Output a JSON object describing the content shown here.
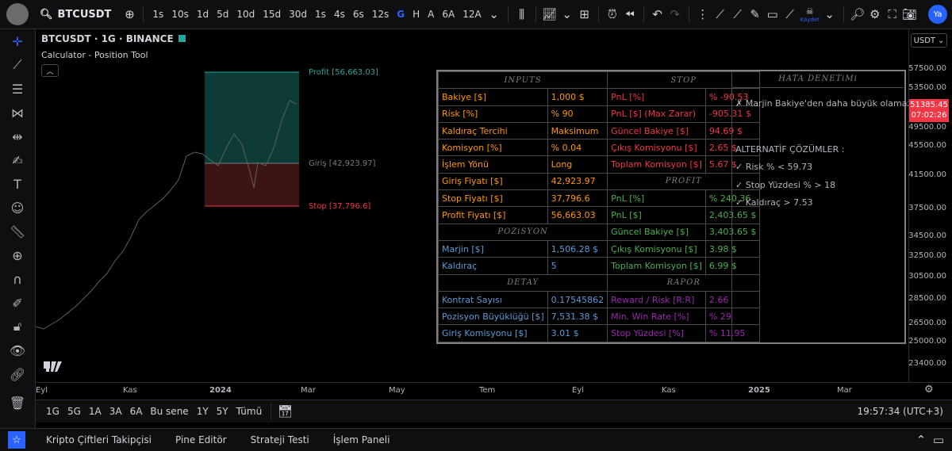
{
  "topbar": {
    "symbol": "BTCUSDT",
    "intervals": [
      "1s",
      "10s",
      "1d",
      "5d",
      "10d",
      "15d",
      "30d",
      "1s",
      "4s",
      "6s",
      "12s",
      "G",
      "H",
      "A",
      "6A",
      "12A"
    ],
    "active_interval": "G",
    "profile_label": "Ya",
    "save_label": "Kaydet"
  },
  "chart": {
    "title": "BTCUSDT · 1G · BINANCE",
    "indicator": "Calculator - Position Tool",
    "profit_label": "Profit [56,663.03]",
    "entry_label": "Giriş [42,923.97]",
    "stop_label": "Stop [37,796.6]",
    "currency": "USDT",
    "current_price": "51385.45",
    "countdown": "07:02:26",
    "price_ticks": [
      "57500.00",
      "53500.00",
      "49500.00",
      "45500.00",
      "41500.00",
      "37500.00",
      "34500.00",
      "32500.00",
      "30500.00",
      "28500.00",
      "26500.00",
      "25000.00",
      "23400.00"
    ],
    "time_ticks": [
      "Eyl",
      "Kas",
      "2024",
      "Mar",
      "May",
      "Tem",
      "Eyl",
      "Kas",
      "2025",
      "Mar"
    ]
  },
  "table": {
    "inputs_header": "INPUTS",
    "stop_header": "STOP",
    "profit_header": "PROFIT",
    "position_header": "POZiSYON",
    "detail_header": "DETAY",
    "report_header": "RAPOR",
    "check_header": "HATA DENETiMi",
    "inputs": [
      {
        "label": "Bakiye [$]",
        "value": "1,000 $"
      },
      {
        "label": "Risk [%]",
        "value": "% 90"
      },
      {
        "label": "Kaldıraç Tercihi",
        "value": "Maksimum"
      },
      {
        "label": "Komisyon [%]",
        "value": "% 0.04"
      },
      {
        "label": "İşlem Yönü",
        "value": "Long"
      },
      {
        "label": "Giriş Fiyatı [$]",
        "value": "42,923.97"
      },
      {
        "label": "Stop Fiyatı [$]",
        "value": "37,796.6"
      },
      {
        "label": "Profit Fiyatı [$]",
        "value": "56,663.03"
      }
    ],
    "stop": [
      {
        "label": "PnL [%]",
        "value": "% -90.53"
      },
      {
        "label": "PnL [$] (Max Zarar)",
        "value": "-905.31 $"
      },
      {
        "label": "Güncel Bakiye [$]",
        "value": "94.69 $"
      },
      {
        "label": "Çıkış Komisyonu [$]",
        "value": "2.65 $"
      },
      {
        "label": "Toplam Komisyon [$]",
        "value": "5.67 $"
      }
    ],
    "profit": [
      {
        "label": "PnL [%]",
        "value": "% 240.36"
      },
      {
        "label": "PnL [$]",
        "value": "2,403.65 $"
      },
      {
        "label": "Güncel Bakiye [$]",
        "value": "3,403.65 $"
      },
      {
        "label": "Çıkış Komisyonu [$]",
        "value": "3.98 $"
      },
      {
        "label": "Toplam Komisyon [$]",
        "value": "6.99 $"
      }
    ],
    "position": [
      {
        "label": "Marjin [$]",
        "value": "1,506.28 $"
      },
      {
        "label": "Kaldıraç",
        "value": "5"
      }
    ],
    "detail": [
      {
        "label": "Kontrat Sayısı",
        "value": "0.17545862"
      },
      {
        "label": "Pozisyon Büyüklüğü [$]",
        "value": "7,531.38 $"
      },
      {
        "label": "Giriş Komisyonu [$]",
        "value": "3.01 $"
      }
    ],
    "report": [
      {
        "label": "Reward / Risk [R:R]",
        "value": "2.66"
      },
      {
        "label": "Min. Win Rate [%]",
        "value": "% 29"
      },
      {
        "label": "Stop Yüzdesi [%]",
        "value": "% 11.95"
      }
    ],
    "error": "✗ Marjin Bakiye'den daha büyük olamaz!",
    "alt_title": "ALTERNATİF ÇÖZÜMLER :",
    "alternatives": [
      "✓ Risk % < 59.73",
      "✓ Stop Yüzdesi % > 18",
      "✓ Kaldıraç > 7.53"
    ]
  },
  "rangebar": {
    "ranges": [
      "1G",
      "5G",
      "1A",
      "3A",
      "6A",
      "Bu sene",
      "1Y",
      "5Y",
      "Tümü"
    ],
    "clock": "19:57:34 (UTC+3)"
  },
  "bottom": {
    "tabs": [
      "Kripto Çiftleri Takipçisi",
      "Pine Editör",
      "Strateji Testi",
      "İşlem Paneli"
    ]
  },
  "colors": {
    "profit_zone": "#0d3b36",
    "stop_zone": "#3b1414",
    "accent": "#2962ff",
    "price_tag": "#f23645"
  }
}
